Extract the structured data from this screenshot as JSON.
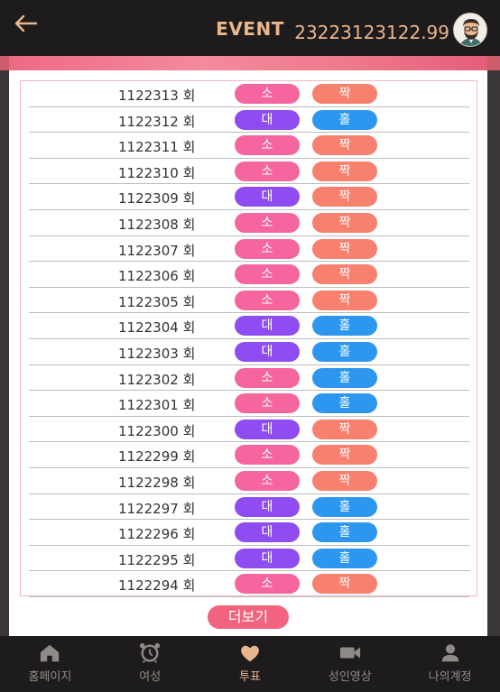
{
  "header": {
    "title": "EVENT",
    "balance": "23223123122.99"
  },
  "colors": {
    "small": "#f5669e",
    "big": "#8f4cf0",
    "odd": "#f7806e",
    "even": "#2d97f0",
    "accent": "#e9b68e"
  },
  "rows": [
    {
      "round": "1122313 회",
      "size": "소",
      "parity": "짝"
    },
    {
      "round": "1122312 회",
      "size": "대",
      "parity": "홀"
    },
    {
      "round": "1122311 회",
      "size": "소",
      "parity": "짝"
    },
    {
      "round": "1122310 회",
      "size": "소",
      "parity": "짝"
    },
    {
      "round": "1122309 회",
      "size": "대",
      "parity": "짝"
    },
    {
      "round": "1122308 회",
      "size": "소",
      "parity": "짝"
    },
    {
      "round": "1122307 회",
      "size": "소",
      "parity": "짝"
    },
    {
      "round": "1122306 회",
      "size": "소",
      "parity": "짝"
    },
    {
      "round": "1122305 회",
      "size": "소",
      "parity": "짝"
    },
    {
      "round": "1122304 회",
      "size": "대",
      "parity": "홀"
    },
    {
      "round": "1122303 회",
      "size": "대",
      "parity": "홀"
    },
    {
      "round": "1122302 회",
      "size": "소",
      "parity": "홀"
    },
    {
      "round": "1122301 회",
      "size": "소",
      "parity": "홀"
    },
    {
      "round": "1122300 회",
      "size": "대",
      "parity": "짝"
    },
    {
      "round": "1122299 회",
      "size": "소",
      "parity": "짝"
    },
    {
      "round": "1122298 회",
      "size": "소",
      "parity": "짝"
    },
    {
      "round": "1122297 회",
      "size": "대",
      "parity": "홀"
    },
    {
      "round": "1122296 회",
      "size": "대",
      "parity": "홀"
    },
    {
      "round": "1122295 회",
      "size": "대",
      "parity": "홀"
    },
    {
      "round": "1122294 회",
      "size": "소",
      "parity": "짝"
    }
  ],
  "more_label": "더보기",
  "nav": [
    {
      "label": "홈페이지",
      "icon": "home-icon"
    },
    {
      "label": "여성",
      "icon": "alarm-clock-icon"
    },
    {
      "label": "투표",
      "icon": "heart-icon"
    },
    {
      "label": "성인영상",
      "icon": "video-camera-icon"
    },
    {
      "label": "나의계정",
      "icon": "user-icon"
    }
  ],
  "active_nav": 2
}
